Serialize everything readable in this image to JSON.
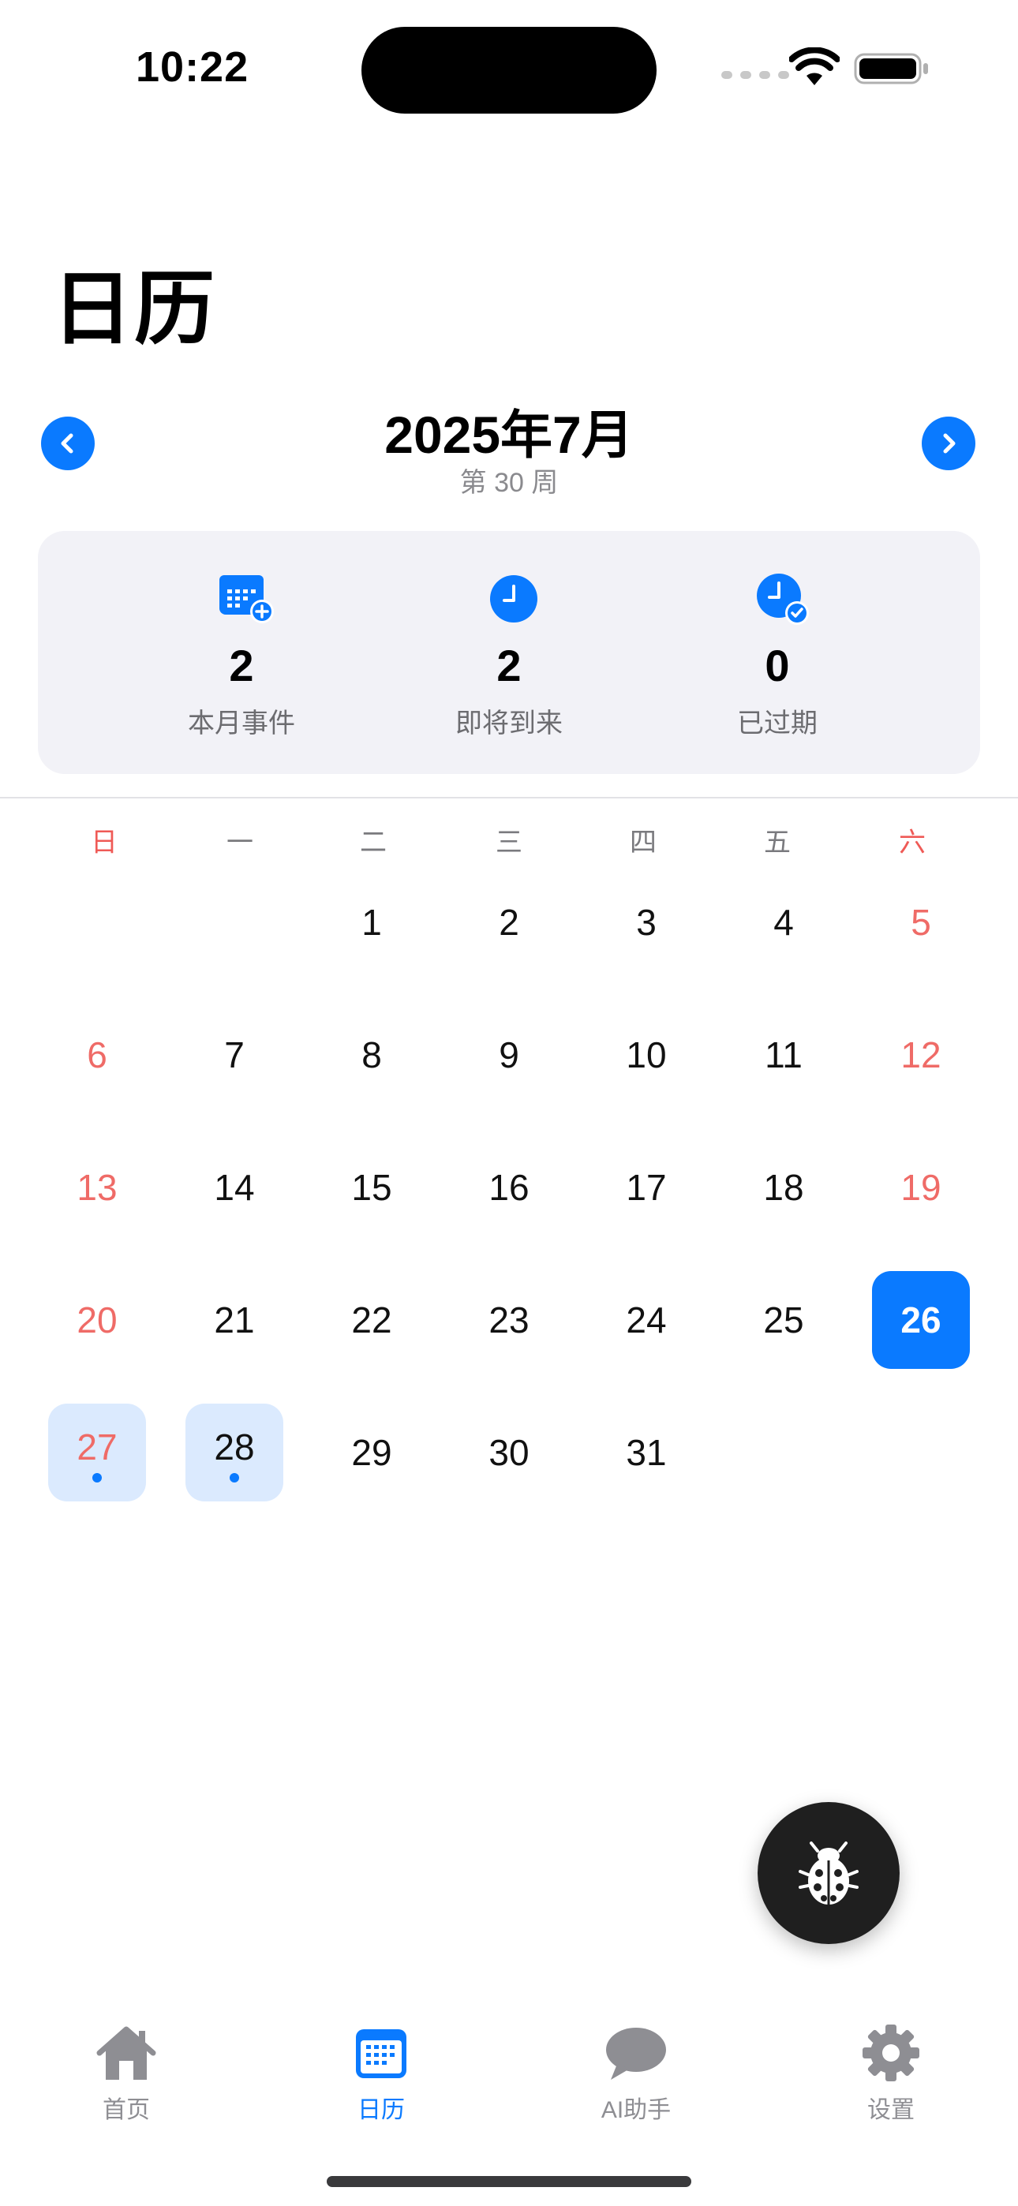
{
  "status_bar": {
    "time": "10:22"
  },
  "header": {
    "title": "日历"
  },
  "month_nav": {
    "title": "2025年7月",
    "week": "第 30 周"
  },
  "stats": [
    {
      "value": "2",
      "label": "本月事件",
      "icon": "calendar-add-icon"
    },
    {
      "value": "2",
      "label": "即将到来",
      "icon": "clock-icon"
    },
    {
      "value": "0",
      "label": "已过期",
      "icon": "clock-check-icon"
    }
  ],
  "calendar": {
    "weekdays": [
      "日",
      "一",
      "二",
      "三",
      "四",
      "五",
      "六"
    ],
    "weeks": [
      [
        "",
        "",
        "1",
        "2",
        "3",
        "4",
        "5"
      ],
      [
        "6",
        "7",
        "8",
        "9",
        "10",
        "11",
        "12"
      ],
      [
        "13",
        "14",
        "15",
        "16",
        "17",
        "18",
        "19"
      ],
      [
        "20",
        "21",
        "22",
        "23",
        "24",
        "25",
        "26"
      ],
      [
        "27",
        "28",
        "29",
        "30",
        "31",
        "",
        ""
      ]
    ],
    "today": "26",
    "event_days": [
      "27",
      "28"
    ]
  },
  "tabbar": {
    "items": [
      {
        "label": "首页",
        "icon": "home-icon"
      },
      {
        "label": "日历",
        "icon": "calendar-icon"
      },
      {
        "label": "AI助手",
        "icon": "chat-bubble-icon"
      },
      {
        "label": "设置",
        "icon": "gear-icon"
      }
    ]
  },
  "colors": {
    "accent": "#0a7aff",
    "weekend": "#ef6b67"
  }
}
